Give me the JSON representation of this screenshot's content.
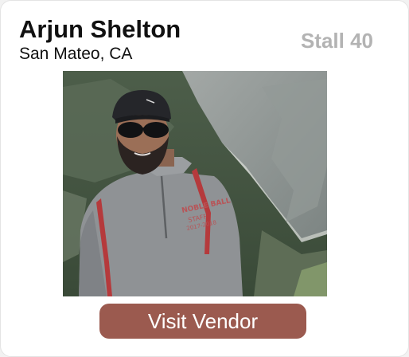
{
  "vendor": {
    "name": "Arjun Shelton",
    "location": "San Mateo, CA",
    "stall": "Stall 40"
  },
  "photo": {
    "alt": "Vendor photo"
  },
  "actions": {
    "visit_label": "Visit Vendor"
  },
  "colors": {
    "button": "#9b5a4f",
    "stall_text": "#b3b3b3",
    "text": "#111111"
  }
}
